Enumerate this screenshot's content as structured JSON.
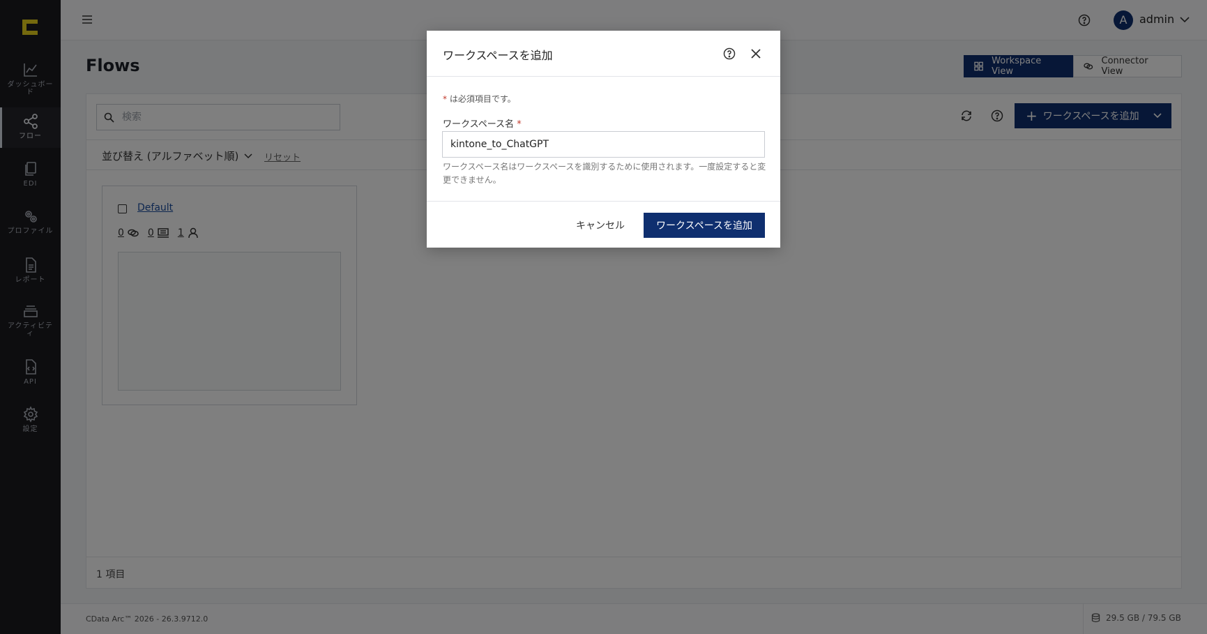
{
  "sidebar": {
    "items": [
      {
        "label": "ダッシュボード",
        "icon": "chart-line-icon"
      },
      {
        "label": "フロー",
        "icon": "share-nodes-icon",
        "active": true
      },
      {
        "label": "EDI",
        "icon": "documents-icon"
      },
      {
        "label": "プロファイル",
        "icon": "gears-icon"
      },
      {
        "label": "レポート",
        "icon": "report-icon"
      },
      {
        "label": "アクティビティ",
        "icon": "stack-icon"
      },
      {
        "label": "API",
        "icon": "api-file-icon"
      },
      {
        "label": "設定",
        "icon": "gear-icon"
      }
    ]
  },
  "topbar": {
    "avatar_initial": "A",
    "user_name": "admin"
  },
  "page": {
    "title": "Flows",
    "view_toggle": {
      "workspace": "Workspace View",
      "connector": "Connector View"
    },
    "search_placeholder": "検索",
    "add_workspace_label": "ワークスペースを追加",
    "sort_label": "並び替え (アルファベット順)",
    "reset_label": "リセット",
    "workspace_card": {
      "name": "Default",
      "connectors_count": "0",
      "flows_count": "0",
      "users_count": "1"
    },
    "item_count": "1 項目"
  },
  "footer": {
    "version": "CData Arc™ 2026 - 26.3.9712.0",
    "storage": "29.5 GB / 79.5 GB"
  },
  "modal": {
    "title": "ワークスペースを追加",
    "required_note_star": "*",
    "required_note": "は必須項目です。",
    "field_label": "ワークスペース名",
    "field_value": "kintone_to_ChatGPT",
    "field_help": "ワークスペース名はワークスペースを識別するために使用されます。一度設定すると変更できません。",
    "cancel_label": "キャンセル",
    "submit_label": "ワークスペースを追加"
  },
  "colors": {
    "primary": "#0f2f6f",
    "sidebar_bg": "#1a1a1f",
    "logo_accent": "#e8d21d"
  }
}
